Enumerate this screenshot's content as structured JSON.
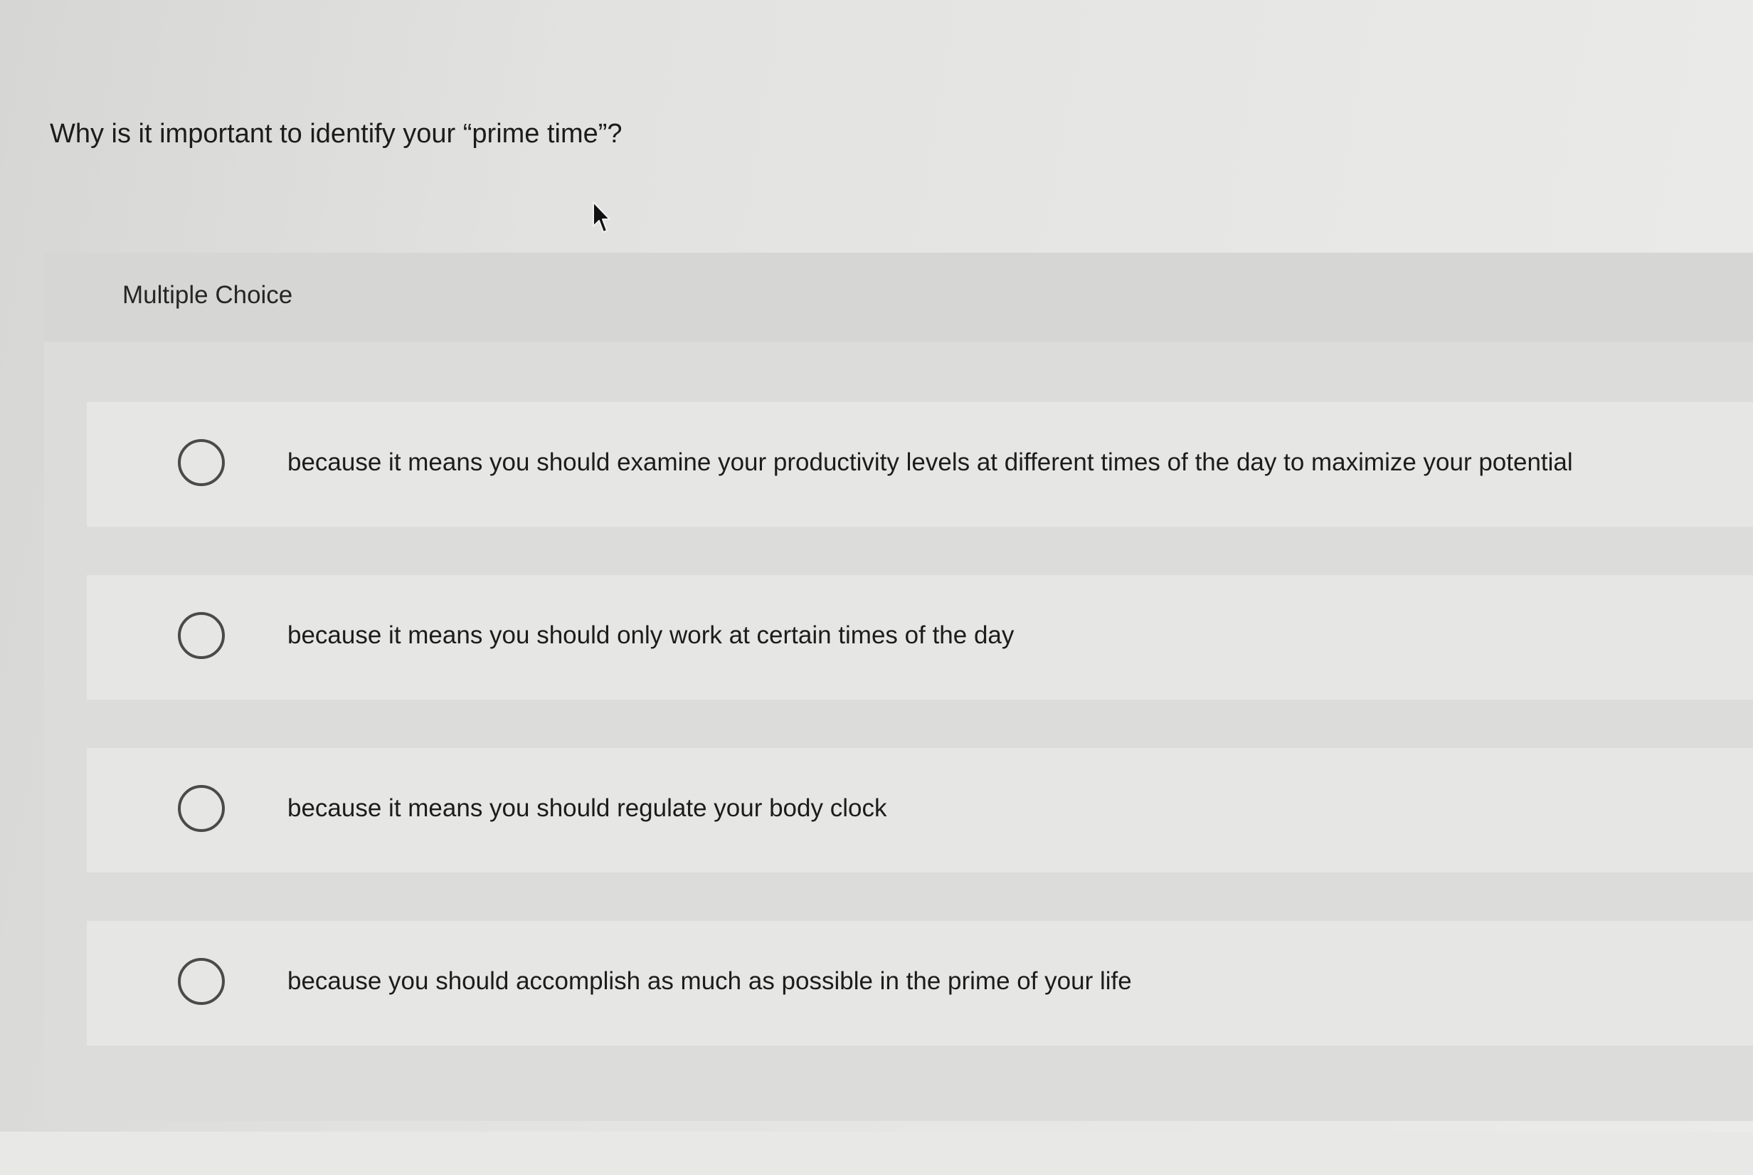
{
  "question": {
    "text": "Why is it important to identify your “prime time”?"
  },
  "question_type": {
    "label": "Multiple Choice"
  },
  "options": [
    {
      "label": "because it means you should examine your productivity levels at different times of the day to maximize your potential",
      "selected": false
    },
    {
      "label": "because it means you should only work at certain times of the day",
      "selected": false
    },
    {
      "label": "because it means you should regulate your body clock",
      "selected": false
    },
    {
      "label": "because you should accomplish as much as possible in the prime of your life",
      "selected": false
    }
  ],
  "icons": {
    "cursor": "mouse-pointer-icon",
    "option_control": "radio-button-icon"
  }
}
